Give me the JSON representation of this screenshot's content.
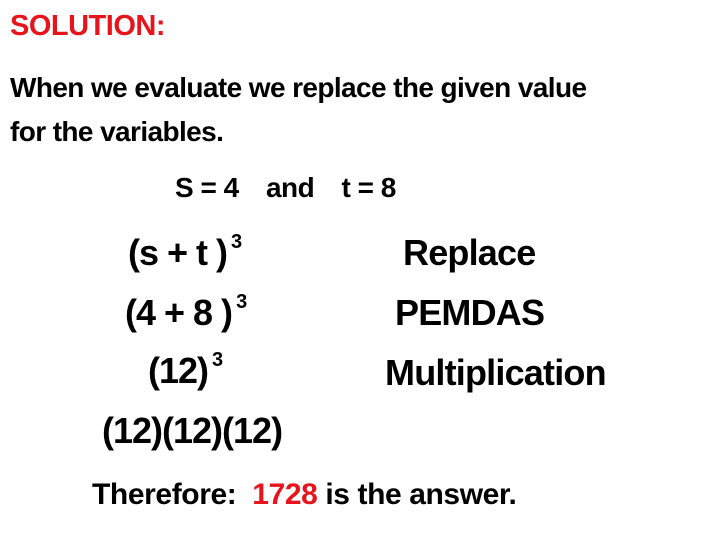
{
  "title": "SOLUTION:",
  "intro": {
    "line1": "When we evaluate we replace the given value",
    "line2": "for the variables."
  },
  "given": {
    "s": "S = 4",
    "joiner": "and",
    "t": "t = 8"
  },
  "steps": [
    {
      "expr": "(s + t )",
      "exponent": "3",
      "note": "Replace"
    },
    {
      "expr": "(4 + 8 )",
      "exponent": "3",
      "note": "PEMDAS"
    },
    {
      "expr": "(12)",
      "exponent": "3",
      "note": "Multiplication"
    },
    {
      "expr": "(12)(12)(12)",
      "exponent": null,
      "note": null
    }
  ],
  "conclusion": {
    "prefix": "Therefore:",
    "answer": "1728",
    "suffix": "is the answer."
  },
  "colors": {
    "accent_red": "#e8141b",
    "text": "#000000",
    "background": "#ffffff"
  }
}
